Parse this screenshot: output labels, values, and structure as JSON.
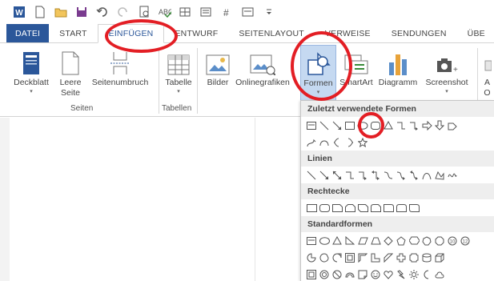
{
  "tabs": [
    "DATEI",
    "START",
    "EINFÜGEN",
    "ENTWURF",
    "SEITENLAYOUT",
    "VERWEISE",
    "SENDUNGEN",
    "ÜBE"
  ],
  "ribbon": {
    "buttons": [
      {
        "line1": "Deckblatt",
        "line2": "",
        "arrow": "▾"
      },
      {
        "line1": "Leere",
        "line2": "Seite",
        "arrow": ""
      },
      {
        "line1": "Seitenumbruch",
        "line2": "",
        "arrow": ""
      },
      {
        "line1": "Tabelle",
        "line2": "",
        "arrow": "▾"
      },
      {
        "line1": "Bilder",
        "line2": "",
        "arrow": ""
      },
      {
        "line1": "Onlinegrafiken",
        "line2": "",
        "arrow": ""
      },
      {
        "line1": "Formen",
        "line2": "",
        "arrow": "▾"
      },
      {
        "line1": "SmartArt",
        "line2": "",
        "arrow": ""
      },
      {
        "line1": "Diagramm",
        "line2": "",
        "arrow": ""
      },
      {
        "line1": "Screenshot",
        "line2": "",
        "arrow": "▾"
      },
      {
        "line1": "A",
        "line2": "O",
        "arrow": ""
      }
    ],
    "groups": [
      "Seiten",
      "Tabellen"
    ]
  },
  "shapes_menu": {
    "sections": [
      "Zuletzt verwendete Formen",
      "Linien",
      "Rechtecke",
      "Standardformen"
    ]
  },
  "colors": {
    "file_tab": "#2b579a",
    "accent": "#2b579a",
    "annotation": "#e31e24"
  }
}
